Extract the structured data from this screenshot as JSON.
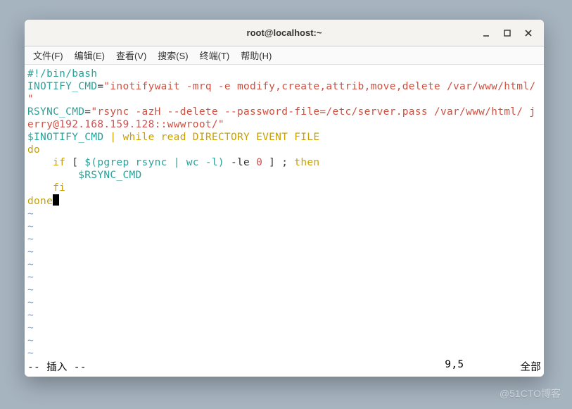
{
  "window": {
    "title": "root@localhost:~"
  },
  "menu": {
    "file": "文件(F)",
    "edit": "编辑(E)",
    "view": "查看(V)",
    "search": "搜索(S)",
    "terminal": "终端(T)",
    "help": "帮助(H)"
  },
  "code": {
    "shebang_prefix": "#!/",
    "shebang_bin": "bin",
    "shebang_slash": "/",
    "shebang_bash": "bash",
    "inotify_var": "INOTIFY_CMD",
    "eq": "=",
    "dq": "\"",
    "inotify_str": "inotifywait -mrq -e modify,create,attrib,move,delete /var/www/html/",
    "rsync_var": "RSYNC_CMD",
    "rsync_str1": "rsync -azH --delete --password-file=/etc/server.pass /var/www/html/ j",
    "rsync_str2a": "erry@",
    "rsync_ip": "192.168.159.128",
    "rsync_str2b": "::wwwroot/",
    "dollar": "$",
    "inotify_ref": "INOTIFY_CMD",
    "pipe_while": " | while read DIRECTORY EVENT FILE",
    "do": "do",
    "if_indent": "    ",
    "if_kw": "if",
    "if_cond_a": " [ ",
    "if_dollar_open": "$(",
    "if_pgrep": "pgrep rsync | wc -l",
    "if_close_paren": ")",
    "if_mid": " -le ",
    "if_zero": "0",
    "if_end": " ] ; ",
    "then_kw": "then",
    "rsync_indent": "        ",
    "rsync_ref": "RSYNC_CMD",
    "fi_indent": "    ",
    "fi": "fi",
    "done": "done",
    "tilde": "~"
  },
  "status": {
    "mode": "-- 插入 --",
    "position": "9,5",
    "scroll": "全部"
  },
  "watermark": "@51CTO博客"
}
